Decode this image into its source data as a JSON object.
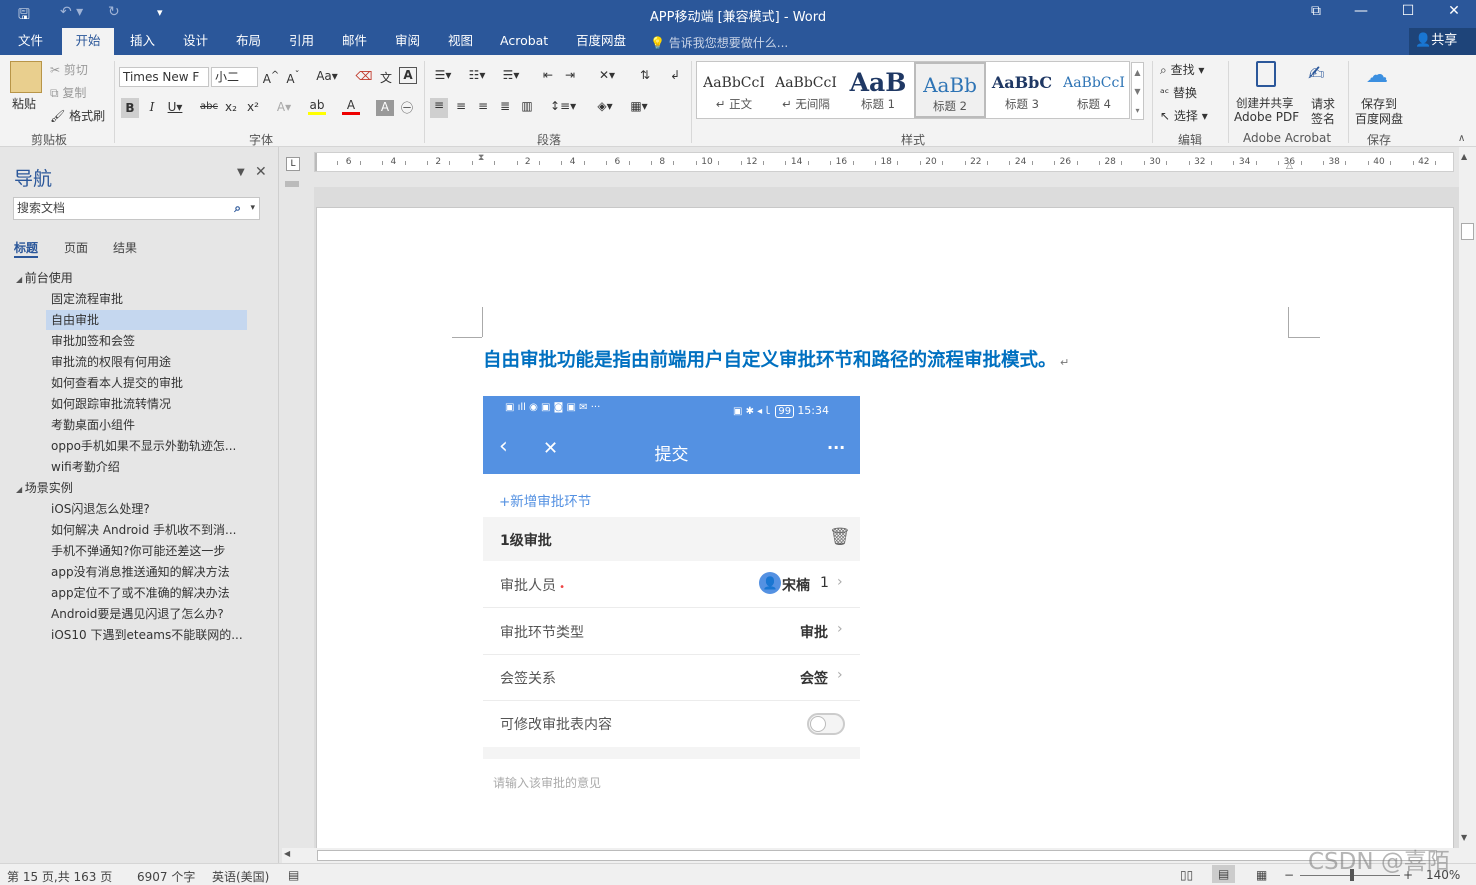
{
  "window": {
    "title": "APP移动端 [兼容模式] - Word",
    "min": "—",
    "max": "☐",
    "close": "✕",
    "restore": "⧉"
  },
  "tabs": [
    "文件",
    "开始",
    "插入",
    "设计",
    "布局",
    "引用",
    "邮件",
    "审阅",
    "视图",
    "Acrobat",
    "百度网盘"
  ],
  "tellme": "告诉我您想要做什么...",
  "share": "共享",
  "clipboard": {
    "paste": "粘贴",
    "cut": "剪切",
    "copy": "复制",
    "painter": "格式刷",
    "label": "剪贴板"
  },
  "font": {
    "name": "Times New F",
    "size": "小二",
    "label": "字体"
  },
  "paragraph": {
    "label": "段落"
  },
  "styles": {
    "label": "样式",
    "items": [
      {
        "preview": "AaBbCcI",
        "name": "↵ 正文"
      },
      {
        "preview": "AaBbCcI",
        "name": "↵ 无间隔"
      },
      {
        "preview": "AaB",
        "name": "标题 1"
      },
      {
        "preview": "AaBb",
        "name": "标题 2"
      },
      {
        "preview": "AaBbC",
        "name": "标题 3"
      },
      {
        "preview": "AaBbCcI",
        "name": "标题 4"
      }
    ]
  },
  "editing": {
    "find": "查找",
    "replace": "替换",
    "select": "选择",
    "label": "编辑"
  },
  "acrobat": {
    "create1": "创建并共享",
    "create2": "Adobe PDF",
    "sign1": "请求",
    "sign2": "签名",
    "label": "Adobe Acrobat"
  },
  "baidu": {
    "save1": "保存到",
    "save2": "百度网盘",
    "label": "保存"
  },
  "nav": {
    "title": "导航",
    "search": "搜索文档",
    "tabs": [
      "标题",
      "页面",
      "结果"
    ],
    "items": [
      {
        "text": "前台使用",
        "level": 1
      },
      {
        "text": "固定流程审批",
        "level": 2
      },
      {
        "text": "自由审批",
        "level": 2,
        "selected": true
      },
      {
        "text": "审批加签和会签",
        "level": 2
      },
      {
        "text": "审批流的权限有何用途",
        "level": 2
      },
      {
        "text": "如何查看本人提交的审批",
        "level": 2
      },
      {
        "text": "如何跟踪审批流转情况",
        "level": 2
      },
      {
        "text": "考勤桌面小组件",
        "level": 2
      },
      {
        "text": "oppo手机如果不显示外勤轨迹怎...",
        "level": 2
      },
      {
        "text": "wifi考勤介绍",
        "level": 2
      },
      {
        "text": "场景实例",
        "level": 1
      },
      {
        "text": "iOS闪退怎么处理?",
        "level": 2
      },
      {
        "text": "如何解决 Android 手机收不到消...",
        "level": 2
      },
      {
        "text": "手机不弹通知?你可能还差这一步",
        "level": 2
      },
      {
        "text": "app没有消息推送通知的解决方法",
        "level": 2
      },
      {
        "text": "app定位不了或不准确的解决办法",
        "level": 2
      },
      {
        "text": "Android要是遇见闪退了怎么办?",
        "level": 2
      },
      {
        "text": "iOS10 下遇到eteams不能联网的...",
        "level": 2
      }
    ]
  },
  "ruler": {
    "labels": [
      "6",
      "4",
      "2",
      "2",
      "4",
      "6",
      "8",
      "10",
      "12",
      "14",
      "16",
      "18",
      "20",
      "22",
      "24",
      "26",
      "28",
      "30",
      "32",
      "34",
      "36",
      "38",
      "40",
      "42"
    ]
  },
  "document": {
    "heading": "自由审批功能是指由前端用户自定义审批环节和路径的流程审批模式。",
    "phone": {
      "time": "15:34",
      "battery": "99",
      "title": "提交",
      "add": "+新增审批环节",
      "section": "1级审批",
      "rows": [
        {
          "label": "审批人员",
          "value": "宋楠",
          "count": "1"
        },
        {
          "label": "审批环节类型",
          "value": "审批"
        },
        {
          "label": "会签关系",
          "value": "会签"
        },
        {
          "label": "可修改审批表内容"
        }
      ],
      "comment_placeholder": "请输入该审批的意见"
    }
  },
  "status": {
    "page": "第 15 页,共 163 页",
    "words": "6907 个字",
    "lang": "英语(美国)",
    "zoom": "140%"
  },
  "watermark": "CSDN @喜陌",
  "colors": {
    "brand": "#2b579a",
    "heading": "#0070c0",
    "phone_header": "#5491e2"
  }
}
